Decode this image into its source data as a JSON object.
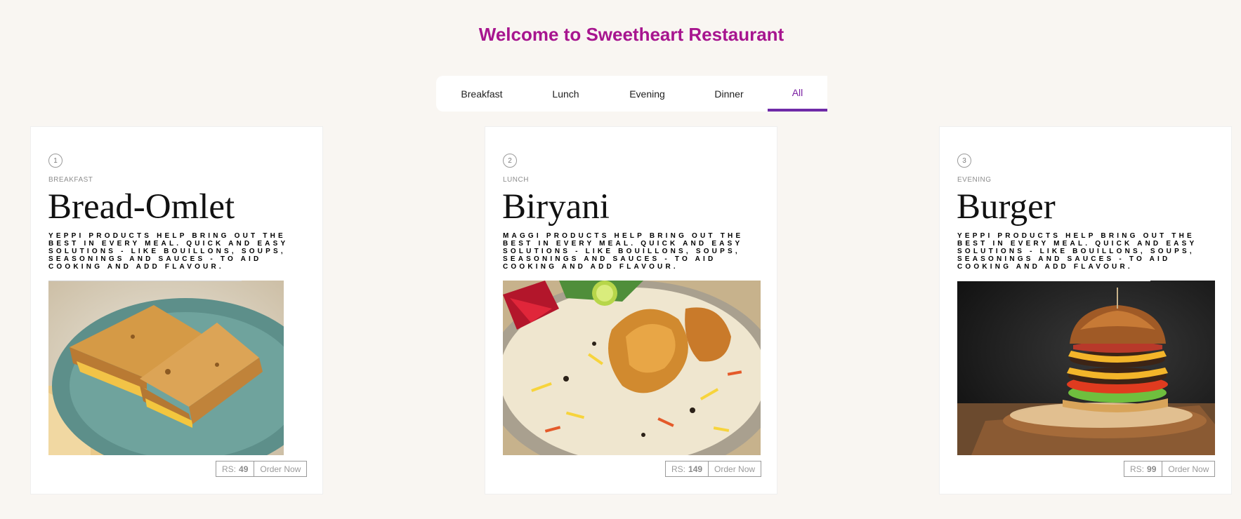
{
  "title": "Welcome to Sweetheart Restaurant",
  "tabs": [
    "Breakfast",
    "Lunch",
    "Evening",
    "Dinner",
    "All"
  ],
  "active_tab": "All",
  "accent_color": "#a7158f",
  "tab_active_color": "#6f2aa8",
  "cards": [
    {
      "number": "1",
      "category": "BREAKFAST",
      "name": "Bread-Omlet",
      "description": "Yeppi products help bring out the best in every meal. Quick and easy solutions - like bouillons, soups, seasonings and sauces - to aid cooking and add flavour.",
      "price_label": "RS:",
      "price": "49",
      "order_label": "Order Now",
      "image_icon": "bread-omelette-sandwich-photo"
    },
    {
      "number": "2",
      "category": "LUNCH",
      "name": "Biryani",
      "description": "Maggi products help bring out the best in every meal. Quick and easy solutions - like bouillons, soups, seasonings and sauces - to aid cooking and add flavour.",
      "price_label": "RS:",
      "price": "149",
      "order_label": "Order Now",
      "image_icon": "chicken-biryani-photo"
    },
    {
      "number": "3",
      "category": "EVENING",
      "name": "Burger",
      "description": "Yeppi products help bring out the best in every meal. Quick and easy solutions - like bouillons, soups, seasonings and sauces - to aid cooking and add flavour.",
      "price_label": "RS:",
      "price": "99",
      "order_label": "Order Now",
      "image_icon": "double-cheeseburger-photo"
    }
  ]
}
